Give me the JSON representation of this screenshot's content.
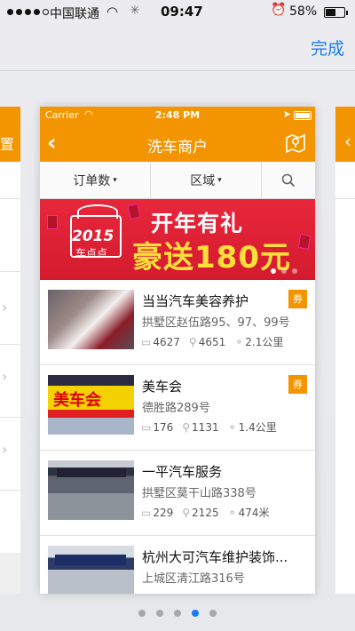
{
  "status_bar": {
    "carrier": "中国联通",
    "time": "09:47",
    "battery": "58%",
    "signal_filled": 4,
    "signal_total": 5
  },
  "nav": {
    "done_label": "完成"
  },
  "inner": {
    "status": {
      "carrier": "Carrier",
      "time": "2:48 PM"
    },
    "title": "洗车商户",
    "filters": {
      "orders": "订单数",
      "area": "区域"
    },
    "banner": {
      "brand_year": "2015",
      "brand_name": "车点点",
      "line1": "开年有礼",
      "line2": "豪送180元"
    },
    "badge_label": "券",
    "merchants": [
      {
        "name": "当当汽车美容养护",
        "address": "拱墅区赵伍路95、97、99号",
        "comments": "4627",
        "washes": "4651",
        "distance": "2.1公里",
        "badge": true
      },
      {
        "name": "美车会",
        "address": "德胜路289号",
        "comments": "176",
        "washes": "1131",
        "distance": "1.4公里",
        "badge": true,
        "thumb_sign": "美车会"
      },
      {
        "name": "一平汽车服务",
        "address": "拱墅区莫干山路338号",
        "comments": "229",
        "washes": "2125",
        "distance": "474米",
        "badge": false
      },
      {
        "name": "杭州大可汽车维护装饰...",
        "address": "上城区清江路316号",
        "badge": false
      }
    ]
  },
  "page_dots": {
    "count": 5,
    "active": 3
  },
  "colors": {
    "accent_orange": "#f39500",
    "link_blue": "#1a7cf5",
    "banner_red": "#e8273b",
    "banner_yellow": "#ffdf3a"
  }
}
